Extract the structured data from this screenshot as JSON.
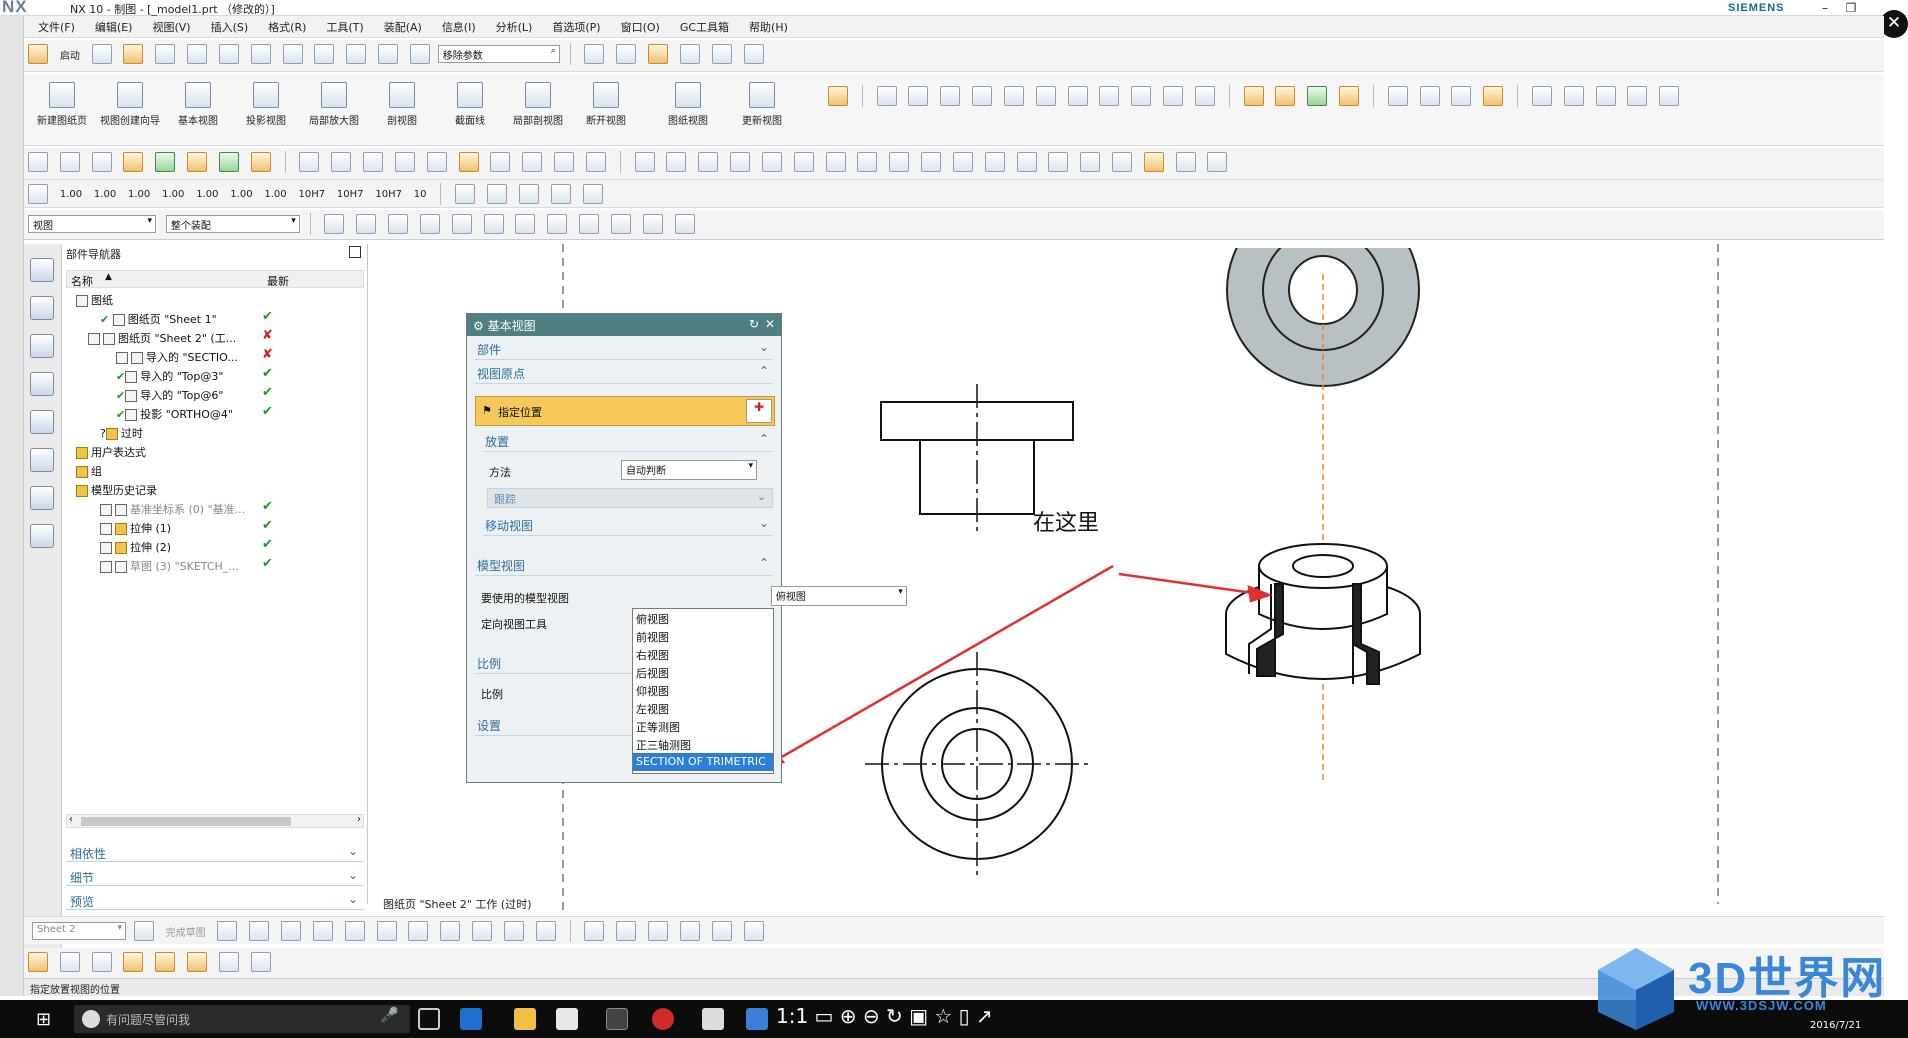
{
  "window": {
    "logo": "NX",
    "title": "NX 10 - 制图 - [_model1.prt （修改的）]",
    "brand": "SIEMENS",
    "min_icon": "minimize-icon",
    "restore_icon": "restore-icon",
    "close_icon": "close-icon"
  },
  "menu": [
    "文件(F)",
    "编辑(E)",
    "视图(V)",
    "插入(S)",
    "格式(R)",
    "工具(T)",
    "装配(A)",
    "信息(I)",
    "分析(L)",
    "首选项(P)",
    "窗口(O)",
    "GC工具箱",
    "帮助(H)"
  ],
  "toolbar1": {
    "start_label": "启动",
    "search_placeholder": "移除参数"
  },
  "ribbon": [
    {
      "label": "新建图纸页",
      "icon": "new-sheet-icon"
    },
    {
      "label": "视图创建向导",
      "icon": "view-wizard-icon"
    },
    {
      "label": "基本视图",
      "icon": "base-view-icon"
    },
    {
      "label": "投影视图",
      "icon": "projected-view-icon"
    },
    {
      "label": "局部放大图",
      "icon": "detail-view-icon"
    },
    {
      "label": "剖视图",
      "icon": "section-view-icon"
    },
    {
      "label": "截面线",
      "icon": "section-line-icon"
    },
    {
      "label": "局部剖视图",
      "icon": "break-out-section-icon"
    },
    {
      "label": "断开视图",
      "icon": "broken-view-icon"
    },
    {
      "label": "图纸视图",
      "icon": "drawing-view-icon"
    },
    {
      "label": "更新视图",
      "icon": "update-view-icon"
    }
  ],
  "toolbar3": {
    "numbers": [
      "1.00",
      "1.00",
      "1.00",
      "1.00",
      "1.00",
      "1.00",
      "1.00",
      "10H7",
      "10H7",
      "10H7",
      "10"
    ]
  },
  "toolbar4": {
    "filter_select": "视图",
    "scope_select": "整个装配"
  },
  "navigator": {
    "title": "部件导航器",
    "col_name": "名称",
    "col_latest": "最新",
    "rows": [
      {
        "label": "图纸",
        "status": ""
      },
      {
        "label": "图纸页 \"Sheet 1\"",
        "status": "ok"
      },
      {
        "label": "图纸页 \"Sheet 2\" (工...",
        "status": "bad"
      },
      {
        "label": "导入的 \"SECTIO...",
        "status": "bad"
      },
      {
        "label": "导入的 \"Top@3\"",
        "status": "ok"
      },
      {
        "label": "导入的 \"Top@6\"",
        "status": "ok"
      },
      {
        "label": "投影 \"ORTHO@4\"",
        "status": "ok"
      },
      {
        "label": "过时",
        "status": ""
      },
      {
        "label": "用户表达式",
        "status": ""
      },
      {
        "label": "组",
        "status": ""
      },
      {
        "label": "模型历史记录",
        "status": ""
      },
      {
        "label": "基准坐标系 (0) \"基准...",
        "status": "ok"
      },
      {
        "label": "拉伸 (1)",
        "status": "ok"
      },
      {
        "label": "拉伸 (2)",
        "status": "ok"
      },
      {
        "label": "草图 (3) \"SKETCH_...",
        "status": "ok"
      }
    ],
    "panels": [
      "相依性",
      "细节",
      "预览"
    ]
  },
  "dialog": {
    "title": "基本视图",
    "sec_part": "部件",
    "sec_origin": "视图原点",
    "specify_location": "指定位置",
    "sub_placement": "放置",
    "method_label": "方法",
    "method_value": "自动判断",
    "track_label": "跟踪",
    "move_view": "移动视图",
    "sec_model_view": "模型视图",
    "model_view_label": "要使用的模型视图",
    "model_view_value": "俯视图",
    "orient_tool": "定向视图工具",
    "sec_scale": "比例",
    "scale_label": "比例",
    "sec_settings": "设置",
    "options": [
      "俯视图",
      "前视图",
      "右视图",
      "后视图",
      "仰视图",
      "左视图",
      "正等测图",
      "正三轴测图",
      "SECTION OF TRIMETRIC"
    ],
    "selected_option": "SECTION OF TRIMETRIC"
  },
  "canvas": {
    "annotation": "在这里",
    "sheet_label": "图纸页 \"Sheet 2\" 工作 (过时)"
  },
  "bottom_toolbar": {
    "sheet_select": "Sheet 2",
    "finish_sketch": "完成草图"
  },
  "status": "指定放置视图的位置",
  "taskbar": {
    "search_text": "有问题尽管问我",
    "date": "2016/7/21"
  },
  "watermark": {
    "text": "3D世界网",
    "url": "WWW.3DSJW.COM"
  },
  "colors": {
    "dialog_header": "#4e7f82",
    "highlight": "#f6c85a",
    "ok": "#1a9a2a",
    "bad": "#d42020",
    "arrow": "#e23030",
    "selection": "#2b7fd6"
  }
}
